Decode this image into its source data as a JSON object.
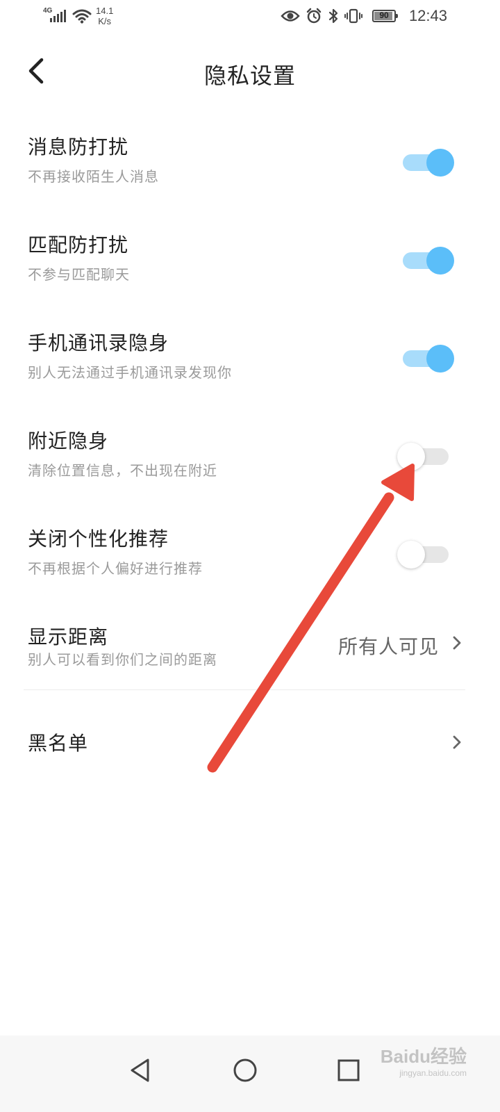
{
  "status_bar": {
    "network_label": "4G",
    "speed_value": "14.1",
    "speed_unit": "K/s",
    "battery_level": "90",
    "time": "12:43"
  },
  "header": {
    "title": "隐私设置"
  },
  "settings": [
    {
      "title": "消息防打扰",
      "subtitle": "不再接收陌生人消息",
      "enabled": true
    },
    {
      "title": "匹配防打扰",
      "subtitle": "不参与匹配聊天",
      "enabled": true
    },
    {
      "title": "手机通讯录隐身",
      "subtitle": "别人无法通过手机通讯录发现你",
      "enabled": true
    },
    {
      "title": "附近隐身",
      "subtitle": "清除位置信息，不出现在附近",
      "enabled": false
    },
    {
      "title": "关闭个性化推荐",
      "subtitle": "不再根据个人偏好进行推荐",
      "enabled": false
    }
  ],
  "distance": {
    "title": "显示距离",
    "subtitle": "别人可以看到你们之间的距离",
    "value": "所有人可见"
  },
  "blacklist": {
    "title": "黑名单"
  },
  "colors": {
    "toggle_on_knob": "#5bbef9",
    "toggle_on_track": "#a8dcfb",
    "toggle_off_track": "#e6e6e6",
    "annotation_arrow": "#e8493a"
  },
  "watermark": {
    "main": "Baidu经验",
    "sub": "jingyan.baidu.com"
  }
}
